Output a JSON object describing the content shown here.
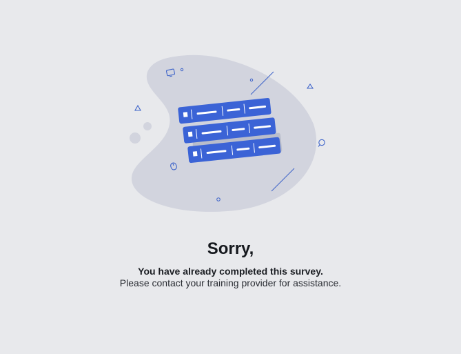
{
  "message": {
    "title": "Sorry,",
    "line1": "You have already completed this survey.",
    "line2": "Please contact your training provider for assistance."
  },
  "colors": {
    "background": "#e8e9ec",
    "blob": "#d2d4de",
    "server_blue": "#3b63d6",
    "outline_blue": "#3d63c9"
  },
  "illustration": {
    "icons": [
      "monitor-icon",
      "mouse-icon",
      "chat-bubble-icon",
      "triangle-icon",
      "circle-icon",
      "server-stack-icon"
    ]
  }
}
